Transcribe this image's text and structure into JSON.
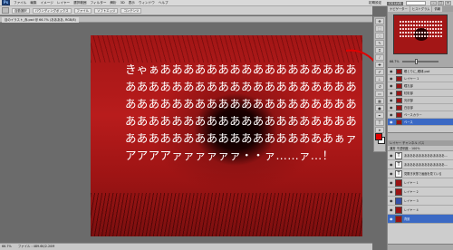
{
  "menubar": {
    "app_logo": "Ps",
    "items": [
      "ファイル",
      "編集",
      "イメージ",
      "レイヤー",
      "選択範囲",
      "フィルター",
      "解析",
      "3D",
      "表示",
      "ウィンドウ",
      "ヘルプ"
    ],
    "workspace": "初期設定",
    "workspace_btn": "CS LIVE"
  },
  "optionsbar": {
    "items": [
      "自動選択",
      "バウンディングボックス",
      "ファイル",
      "ソフトエッジ",
      "コンテンツ"
    ]
  },
  "doctab": {
    "title": "目のイラスト_赤.psd @ 66.7% (ああああ, RGB/8)"
  },
  "canvas": {
    "lines": [
      "きゃぁあああああああああああああああああ",
      "ああああああああああああああああああああ",
      "ああああああああああああああああああああ",
      "ああああああああああああああああああああ",
      "ああああああああああああああああああぁァ",
      "アアアアァァァァァァ・・ァ……ァ…！"
    ]
  },
  "statusbar": {
    "zoom": "66.7%",
    "info": "ファイル : 489.6K/2.20M"
  },
  "dock": {
    "nav_tabs": [
      "ナビゲーター",
      "ヒストグラム",
      "情報"
    ],
    "zoom_value": "66.7%",
    "layer_tabs": [
      "レイヤー",
      "チャンネル",
      "パス"
    ],
    "layer_blend": "通常",
    "layer_opacity": "不透明度 : 100%",
    "small_layers": [
      "眼とりに_眼球.psd",
      "レイヤー 1",
      "瞳孔部",
      "虹彩部",
      "光沢部",
      "白目部",
      "ベースカラー",
      "ベース"
    ],
    "layers": [
      {
        "type": "text",
        "name": "ああああああああああああああ…"
      },
      {
        "type": "text",
        "name": "ああああああああああああああ…"
      },
      {
        "type": "text",
        "name": "見開き状態で画面を見ている"
      },
      {
        "type": "image",
        "name": "レイヤー 1"
      },
      {
        "type": "image",
        "name": "レイヤー 2"
      },
      {
        "type": "blue",
        "name": "レイヤー 3"
      },
      {
        "type": "image",
        "name": "レイヤー 4"
      },
      {
        "type": "image",
        "name": "背景"
      }
    ]
  },
  "colors": {
    "foreground": "#e10000",
    "background": "#ffffff",
    "selection": "#3b69c4"
  }
}
